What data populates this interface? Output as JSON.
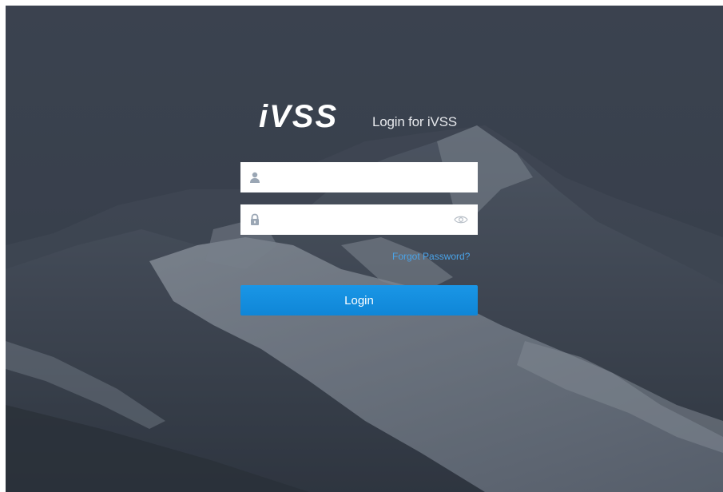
{
  "brand": {
    "logo_text": "iVSS",
    "login_title": "Login for iVSS"
  },
  "username": {
    "value": "",
    "icon": "user-icon"
  },
  "password": {
    "value": "",
    "icon": "lock-icon",
    "toggle_icon": "eye-icon"
  },
  "links": {
    "forgot_password": "Forgot Password?"
  },
  "actions": {
    "login_label": "Login"
  },
  "colors": {
    "background": "#3c4350",
    "accent": "#1a96e6",
    "link": "#4aa3e8",
    "field_background": "#ffffff"
  }
}
